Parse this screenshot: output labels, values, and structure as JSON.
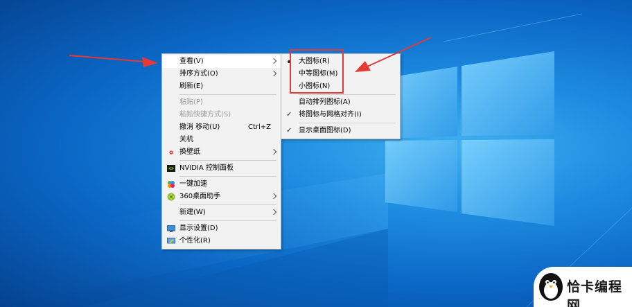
{
  "colors": {
    "desktop_dark": "#04428f",
    "desktop_light": "#3fb0f0",
    "menu_bg": "#f2f2f2",
    "menu_hover": "#ffffff",
    "annotation_red": "#e53935",
    "disabled_text": "#9a9a9a"
  },
  "main_menu": {
    "items": [
      {
        "label": "查看(V)",
        "submenu": true,
        "hover": true
      },
      {
        "label": "排序方式(O)",
        "submenu": true
      },
      {
        "label": "刷新(E)"
      },
      {
        "label": "粘贴(P)",
        "disabled": true
      },
      {
        "label": "粘贴快捷方式(S)",
        "disabled": true
      },
      {
        "label": "撤消 移动(U)",
        "shortcut": "Ctrl+Z"
      },
      {
        "label": "关机"
      },
      {
        "label": "换壁纸",
        "submenu": true,
        "icon": "wallpaper-icon"
      },
      {
        "label": "NVIDIA 控制面板",
        "icon": "nvidia-icon"
      },
      {
        "label": "一键加速",
        "icon": "speedup-icon"
      },
      {
        "label": "360桌面助手",
        "submenu": true,
        "icon": "360-desktop-icon"
      },
      {
        "label": "新建(W)",
        "submenu": true
      },
      {
        "label": "显示设置(D)",
        "icon": "display-settings-icon"
      },
      {
        "label": "个性化(R)",
        "icon": "personalize-icon"
      }
    ]
  },
  "view_submenu": {
    "items": [
      {
        "label": "大图标(R)",
        "marker": "dot"
      },
      {
        "label": "中等图标(M)"
      },
      {
        "label": "小图标(N)"
      },
      {
        "label": "自动排列图标(A)"
      },
      {
        "label": "将图标与网格对齐(I)",
        "marker": "check"
      },
      {
        "label": "显示桌面图标(D)",
        "marker": "check"
      }
    ]
  },
  "watermark": {
    "text": "恰卡编程网",
    "icon": "penguin-logo-icon"
  }
}
